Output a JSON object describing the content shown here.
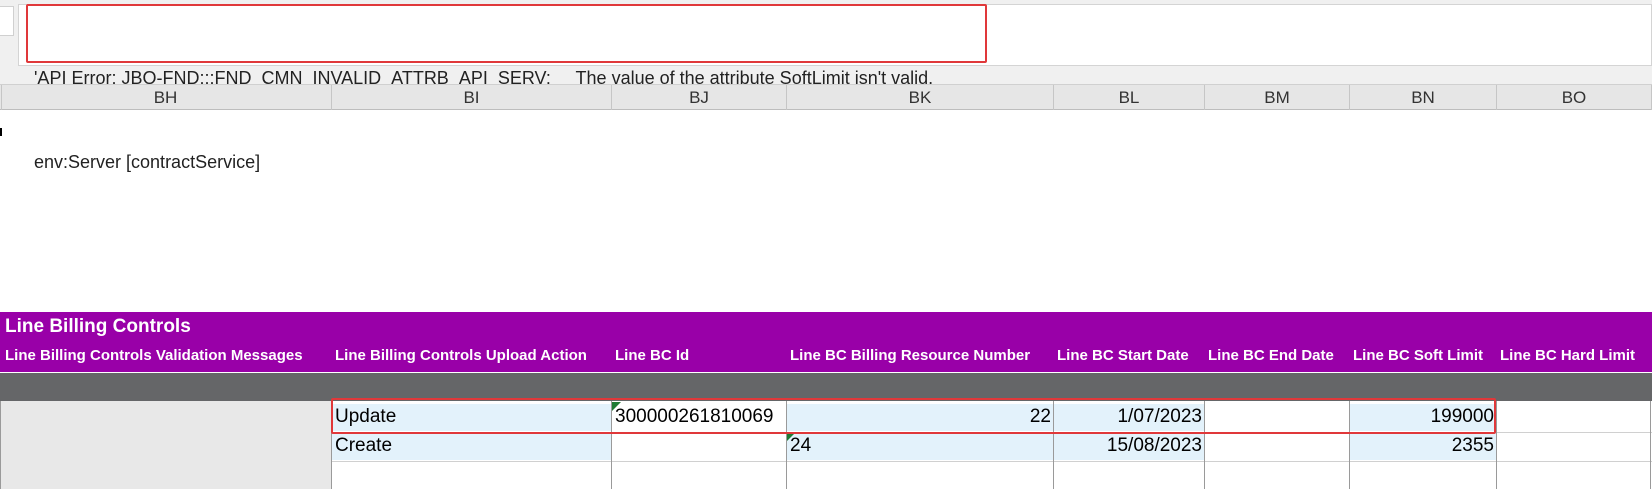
{
  "formula_bar": {
    "line1": "'API Error: JBO-FND:::FND_CMN_INVALID_ATTRB_API_SERV:     The value of the attribute SoftLimit isn't valid.",
    "line2": "env:Server [contractService]"
  },
  "columns": [
    "BH",
    "BI",
    "BJ",
    "BK",
    "BL",
    "BM",
    "BN",
    "BO"
  ],
  "section": {
    "title": "Line Billing Controls",
    "headers": [
      "Line Billing Controls Validation Messages",
      "Line Billing Controls Upload Action",
      "Line BC Id",
      "Line BC Billing Resource Number",
      "Line BC Start Date",
      "Line BC End Date",
      "Line BC Soft Limit",
      "Line BC Hard Limit"
    ]
  },
  "rows": [
    {
      "action": "Update",
      "id": "300000261810069",
      "resource": "22",
      "start": "1/07/2023",
      "end": "",
      "soft": "199000",
      "hard": ""
    },
    {
      "action": "Create",
      "id": "",
      "resource": "24",
      "start": "15/08/2023",
      "end": "",
      "soft": "2355",
      "hard": ""
    }
  ],
  "colors": {
    "section_purple": "#9900a8",
    "highlight_red": "#e0383a",
    "band_gray": "#656668",
    "cell_blue": "#e3f2fb"
  }
}
